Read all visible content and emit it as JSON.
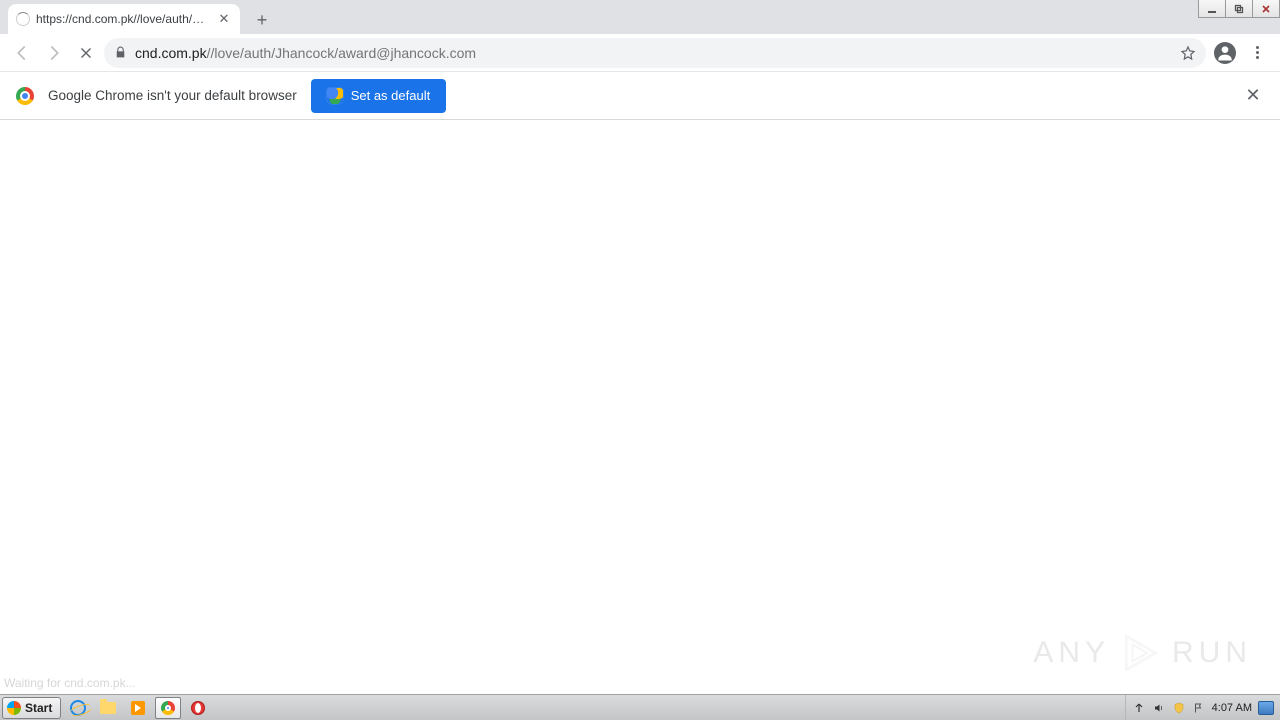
{
  "window": {
    "minimize": "—",
    "maximize": "❐",
    "close": "✕"
  },
  "tab": {
    "title": "https://cnd.com.pk//love/auth/Jhan",
    "close": "✕"
  },
  "newtab": "+",
  "nav": {
    "back": "←",
    "forward": "→",
    "stop": "✕"
  },
  "omnibox": {
    "host": "cnd.com.pk",
    "path": "//love/auth/Jhancock/award@jhancock.com"
  },
  "infobar": {
    "message": "Google Chrome isn't your default browser",
    "button": "Set as default",
    "close": "✕"
  },
  "statusbar": "Waiting for cnd.com.pk...",
  "watermark": {
    "left": "ANY",
    "right": "RUN"
  },
  "taskbar": {
    "start": "Start",
    "clock": "4:07 AM"
  }
}
